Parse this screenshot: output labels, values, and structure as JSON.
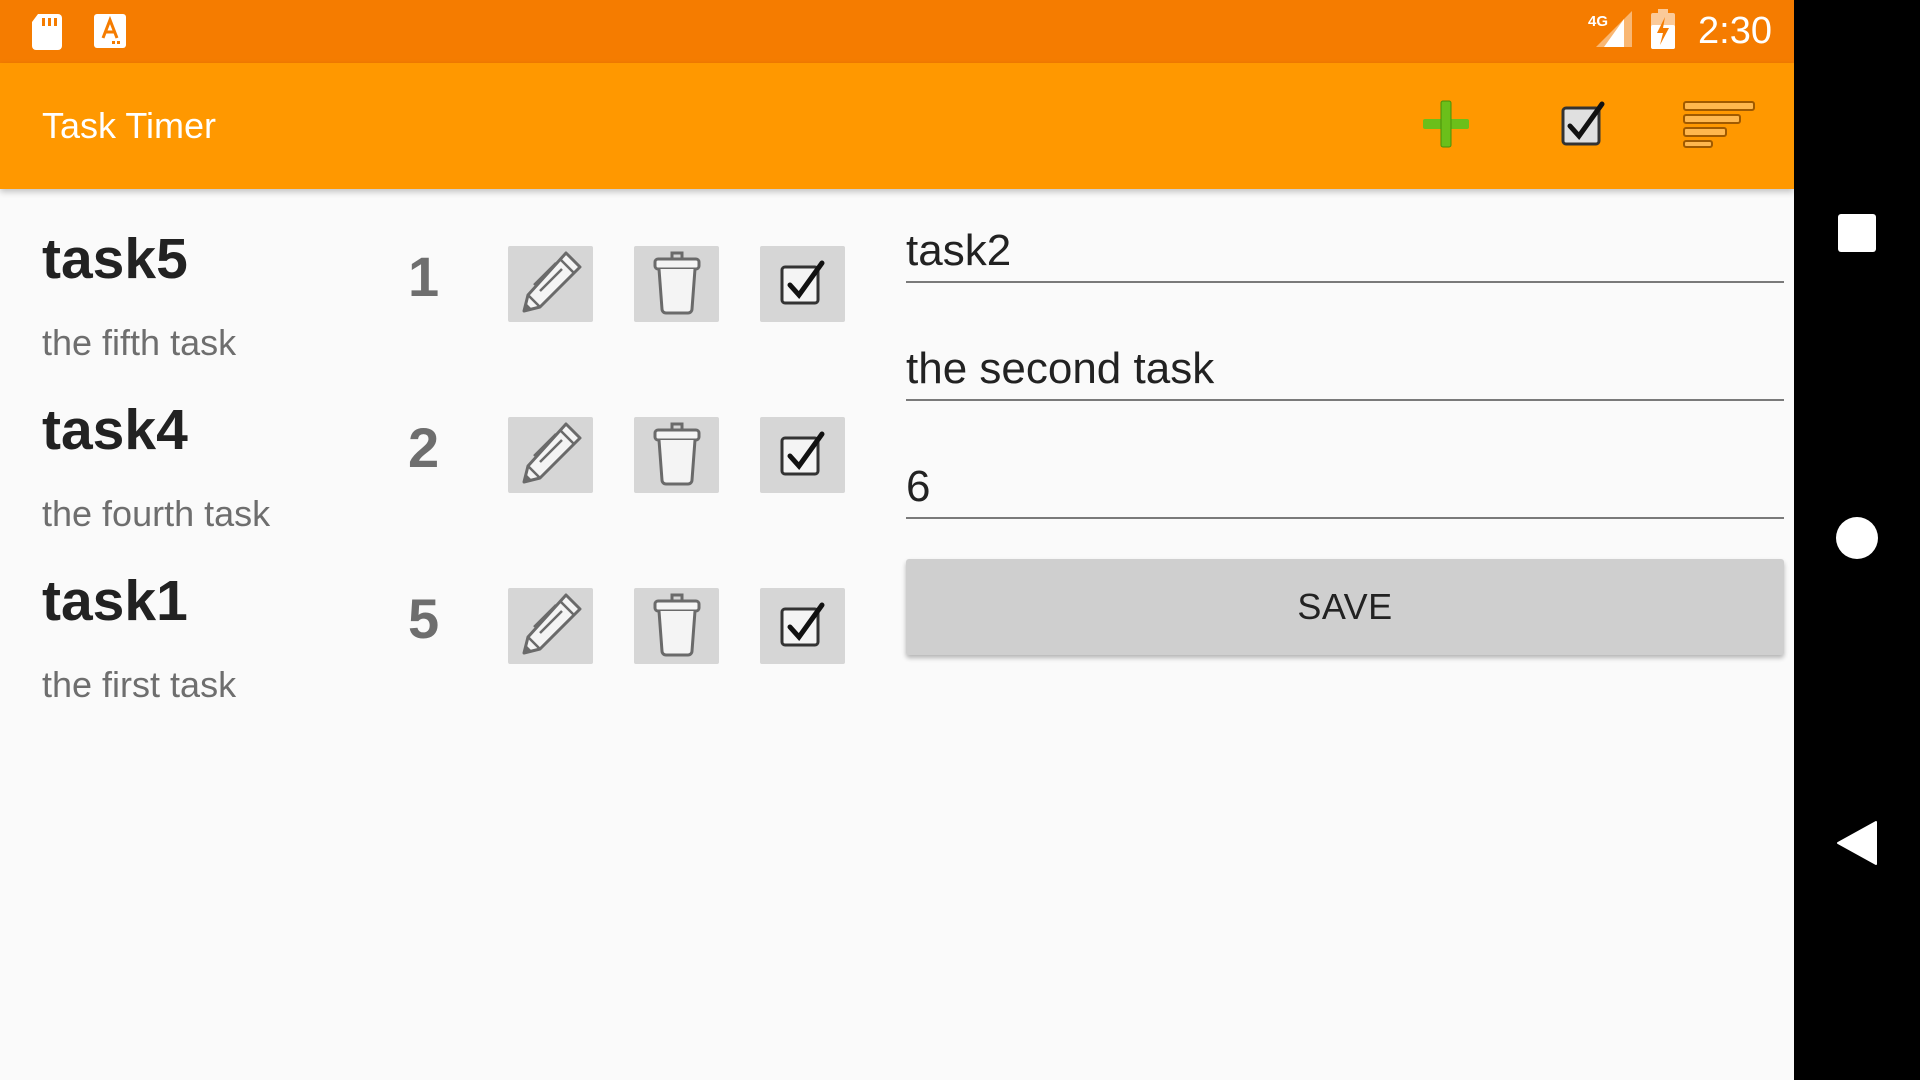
{
  "status_bar": {
    "network": "4G",
    "time": "2:30",
    "icons": [
      "sd-card-icon",
      "font-a-icon",
      "signal-4g-icon",
      "battery-charging-icon"
    ]
  },
  "app_bar": {
    "title": "Task Timer",
    "actions": [
      {
        "name": "add-task",
        "icon": "plus-icon",
        "color": "#4caf50"
      },
      {
        "name": "show-durations",
        "icon": "checkbox-icon"
      },
      {
        "name": "sort",
        "icon": "sort-lines-icon"
      }
    ]
  },
  "colors": {
    "status_bar": "#f57c00",
    "app_bar": "#ff9800",
    "add_icon": "#6bbf1a",
    "button_bg": "#d6d6d6",
    "save_bg": "#cfcfcf"
  },
  "tasks": [
    {
      "name": "task5",
      "description": "the fifth task",
      "order": "1"
    },
    {
      "name": "task4",
      "description": "the fourth task",
      "order": "2"
    },
    {
      "name": "task1",
      "description": "the first task",
      "order": "5"
    }
  ],
  "task_actions": [
    "pencil-icon",
    "trash-icon",
    "checkbox-icon"
  ],
  "edit_form": {
    "name_value": "task2",
    "description_value": "the second task",
    "sort_order_value": "6",
    "save_label": "SAVE"
  },
  "nav_bar": {
    "buttons": [
      "recents-icon",
      "home-icon",
      "back-icon"
    ]
  }
}
